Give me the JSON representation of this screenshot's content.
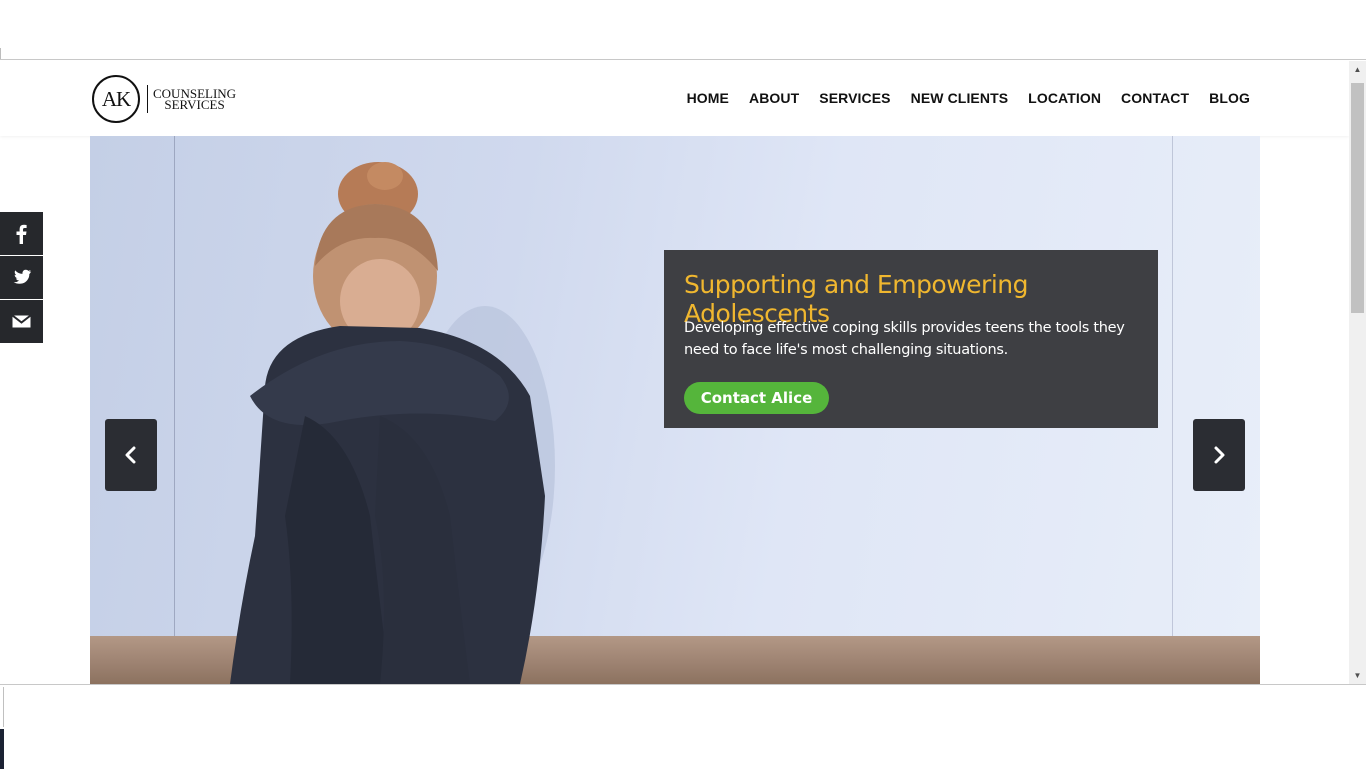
{
  "logo": {
    "initials": "AK",
    "line1": "COUNSELING",
    "line2": "SERVICES"
  },
  "nav": {
    "items": [
      {
        "label": "HOME"
      },
      {
        "label": "ABOUT"
      },
      {
        "label": "SERVICES"
      },
      {
        "label": "NEW CLIENTS"
      },
      {
        "label": "LOCATION"
      },
      {
        "label": "CONTACT"
      },
      {
        "label": "BLOG"
      }
    ]
  },
  "slide": {
    "title": "Supporting and Empowering Adolescents",
    "text": "Developing effective coping skills provides teens the tools they need to face life's most challenging situations.",
    "button": "Contact Alice",
    "image_icon": "teen-sitting-photo"
  },
  "carousel": {
    "prev_icon": "chevron-left-icon",
    "next_icon": "chevron-right-icon"
  },
  "share": {
    "icons": [
      "facebook-icon",
      "twitter-icon",
      "email-icon"
    ]
  },
  "colors": {
    "panel_bg": "#3e3f43",
    "title_accent": "#f0b72f",
    "button_green": "#55b53b",
    "dark_controls": "#2b2d33"
  }
}
